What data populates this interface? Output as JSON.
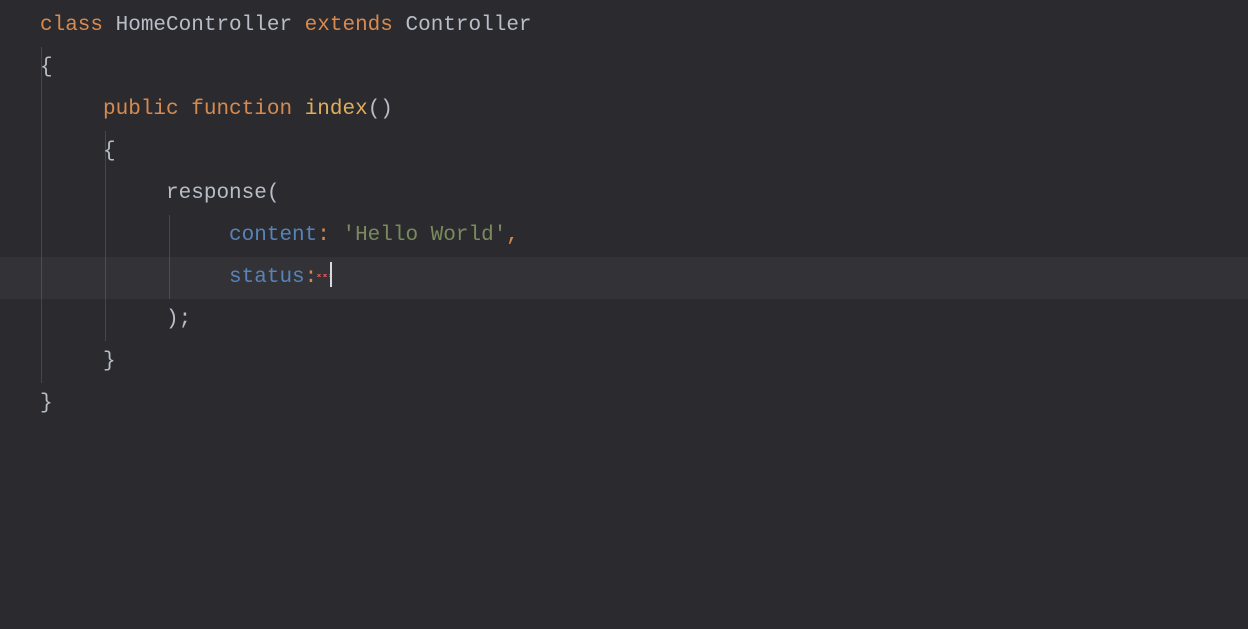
{
  "code": {
    "kw_class": "class",
    "class_name": "HomeController",
    "kw_extends": "extends",
    "parent_class": "Controller",
    "open_brace": "{",
    "kw_public": "public",
    "kw_function": "function",
    "method_name": "index",
    "method_parens": "()",
    "inner_open_brace": "{",
    "fn_call": "response",
    "fn_open": "(",
    "arg1_name": "content",
    "colon": ":",
    "arg1_value": "'Hello World'",
    "comma": ",",
    "arg2_name": "status",
    "fn_close_semi": ");",
    "inner_close_brace": "}",
    "close_brace": "}"
  },
  "colors": {
    "background": "#2b2b2f",
    "keyword": "#d78a4f",
    "identifier": "#b8bdc7",
    "method": "#e0ae5a",
    "named_arg": "#5783b8",
    "string": "#7a8a5e",
    "indent_guide": "#474749",
    "error": "#d35656"
  }
}
